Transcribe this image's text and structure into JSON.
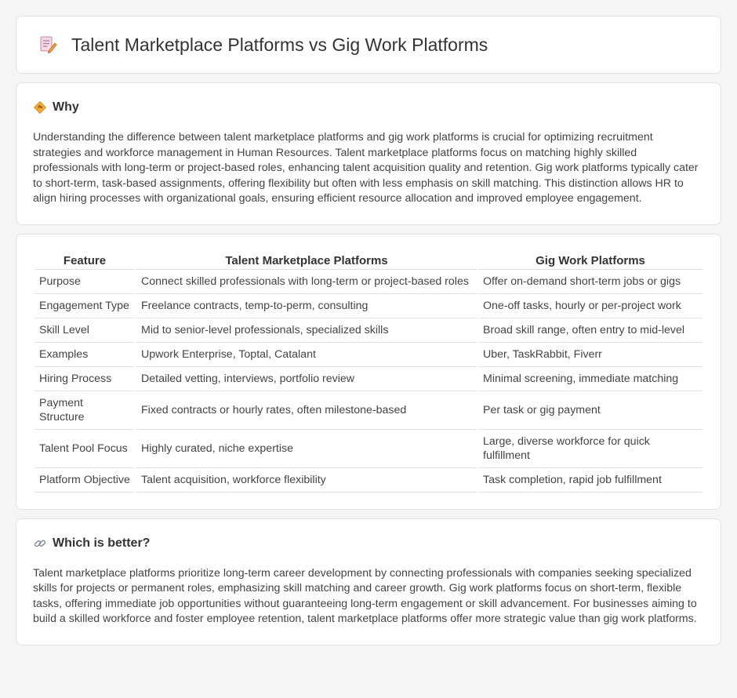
{
  "header": {
    "title": "Talent Marketplace Platforms vs Gig Work Platforms",
    "icon": "document-pencil-icon"
  },
  "why": {
    "heading": "Why",
    "icon": "diamond-warning-icon",
    "body": "Understanding the difference between talent marketplace platforms and gig work platforms is crucial for optimizing recruitment strategies and workforce management in Human Resources. Talent marketplace platforms focus on matching highly skilled professionals with long-term or project-based roles, enhancing talent acquisition quality and retention. Gig work platforms typically cater to short-term, task-based assignments, offering flexibility but often with less emphasis on skill matching. This distinction allows HR to align hiring processes with organizational goals, ensuring efficient resource allocation and improved employee engagement."
  },
  "table": {
    "headers": [
      "Feature",
      "Talent Marketplace Platforms",
      "Gig Work Platforms"
    ],
    "rows": [
      [
        "Purpose",
        "Connect skilled professionals with long-term or project-based roles",
        "Offer on-demand short-term jobs or gigs"
      ],
      [
        "Engagement Type",
        "Freelance contracts, temp-to-perm, consulting",
        "One-off tasks, hourly or per-project work"
      ],
      [
        "Skill Level",
        "Mid to senior-level professionals, specialized skills",
        "Broad skill range, often entry to mid-level"
      ],
      [
        "Examples",
        "Upwork Enterprise, Toptal, Catalant",
        "Uber, TaskRabbit, Fiverr"
      ],
      [
        "Hiring Process",
        "Detailed vetting, interviews, portfolio review",
        "Minimal screening, immediate matching"
      ],
      [
        "Payment Structure",
        "Fixed contracts or hourly rates, often milestone-based",
        "Per task or gig payment"
      ],
      [
        "Talent Pool Focus",
        "Highly curated, niche expertise",
        "Large, diverse workforce for quick fulfillment"
      ],
      [
        "Platform Objective",
        "Talent acquisition, workforce flexibility",
        "Task completion, rapid job fulfillment"
      ]
    ]
  },
  "better": {
    "heading": "Which is better?",
    "icon": "link-icon",
    "body": "Talent marketplace platforms prioritize long-term career development by connecting professionals with companies seeking specialized skills for projects or permanent roles, emphasizing skill matching and career growth. Gig work platforms focus on short-term, flexible tasks, offering immediate job opportunities without guaranteeing long-term engagement or skill advancement. For businesses aiming to build a skilled workforce and foster employee retention, talent marketplace platforms offer more strategic value than gig work platforms."
  }
}
